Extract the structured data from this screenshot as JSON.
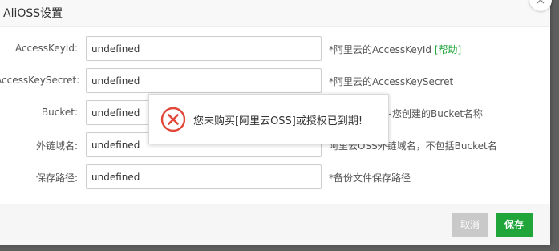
{
  "dialog": {
    "title": "AliOSS设置",
    "close_symbol": "×"
  },
  "form": {
    "rows": [
      {
        "label": "AccessKeyId:",
        "value": "undefined",
        "hint": "*阿里云的AccessKeyId",
        "help_link": "[帮助]"
      },
      {
        "label": "AccessKeySecret:",
        "value": "undefined",
        "hint": "*阿里云的AccessKeySecret"
      },
      {
        "label": "Bucket:",
        "value": "undefined",
        "hint": "中您创建的Bucket名称"
      },
      {
        "label": "外链域名:",
        "value": "undefined",
        "hint": "阿里云OSS外链域名，不包括Bucket名"
      },
      {
        "label": "保存路径:",
        "value": "undefined",
        "hint": "*备份文件保存路径"
      }
    ]
  },
  "footer": {
    "cancel_label": "取消",
    "save_label": "保存"
  },
  "toast": {
    "message": "您未购买[阿里云OSS]或授权已到期!",
    "icon": "error-circle-icon"
  },
  "colors": {
    "accent": "#20a53a",
    "error": "#e2483a",
    "cancel_disabled": "#c9c9c9"
  }
}
